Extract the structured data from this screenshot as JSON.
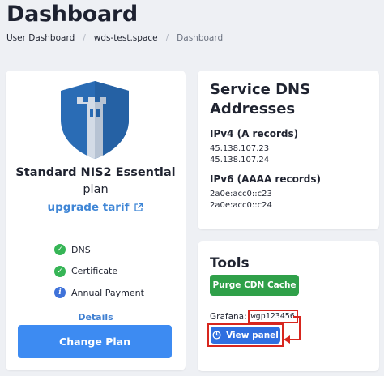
{
  "page": {
    "title": "Dashboard"
  },
  "breadcrumb": [
    "User Dashboard",
    "wds-test.space",
    "Dashboard"
  ],
  "plan_card": {
    "name": "Standard NIS2 Essential",
    "subtitle": "plan",
    "upgrade_label": "upgrade tarif",
    "features": [
      {
        "label": "DNS",
        "icon": "check-circle-icon"
      },
      {
        "label": "Certificate",
        "icon": "check-circle-icon"
      },
      {
        "label": "Annual Payment",
        "icon": "info-circle-icon"
      }
    ],
    "details_label": "Details",
    "change_plan_label": "Change Plan",
    "colors": {
      "shield_blue": "#2a6cb5",
      "shield_light": "#d3dbe6",
      "button": "#3d8bf2"
    }
  },
  "dns_card": {
    "title": "Service DNS Addresses",
    "ipv4_label": "IPv4 (A records)",
    "ipv4": [
      "45.138.107.23",
      "45.138.107.24"
    ],
    "ipv6_label": "IPv6 (AAAA records)",
    "ipv6": [
      "2a0e:acc0::c23",
      "2a0e:acc0::c24"
    ]
  },
  "tools_card": {
    "title": "Tools",
    "purge_label": "Purge CDN Cache",
    "grafana_label": "Grafana:",
    "grafana_user": "wgp123456",
    "view_panel_label": "View panel",
    "colors": {
      "purge": "#2fa049",
      "view_panel": "#2f6fe0",
      "highlight": "#d7261e"
    }
  }
}
